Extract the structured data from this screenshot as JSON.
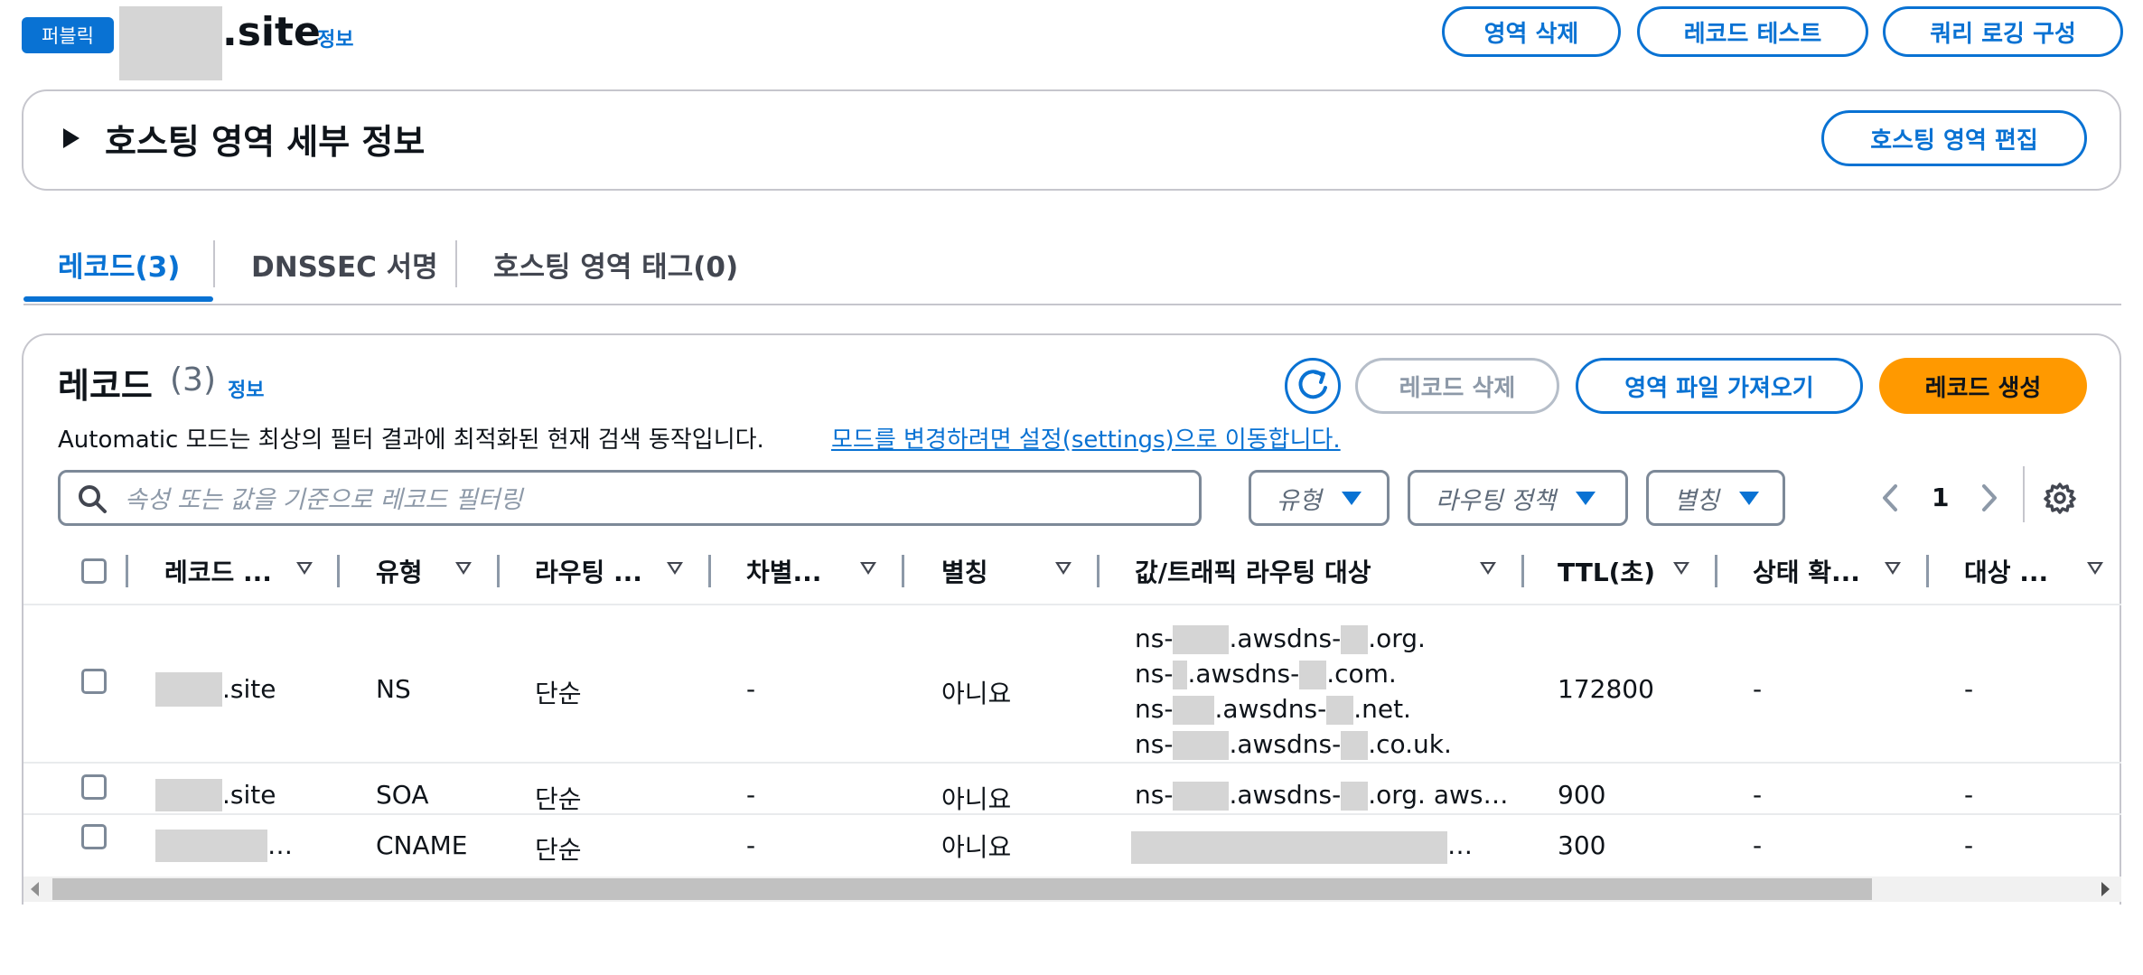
{
  "header": {
    "badge": "퍼블릭",
    "zone_name": ".site",
    "info": "정보",
    "buttons": {
      "delete_zone": "영역 삭제",
      "test_record": "레코드 테스트",
      "query_logging": "쿼리 로깅 구성"
    }
  },
  "details": {
    "title": "호스팅 영역 세부 정보",
    "edit_button": "호스팅 영역 편집"
  },
  "tabs": [
    {
      "label": "레코드(3)",
      "active": true
    },
    {
      "label": "DNSSEC 서명",
      "active": false
    },
    {
      "label": "호스팅 영역 태그(0)",
      "active": false
    }
  ],
  "records": {
    "title": "레코드",
    "count": "(3)",
    "info": "정보",
    "description": "Automatic 모드는 최상의 필터 결과에 최적화된 현재 검색 동작입니다.",
    "description_link": "모드를 변경하려면 설정(settings)으로 이동합니다.",
    "buttons": {
      "delete": "레코드 삭제",
      "import": "영역 파일 가져오기",
      "create": "레코드 생성"
    },
    "search_placeholder": "속성 또는 값을 기준으로 레코드 필터링",
    "filters": {
      "type": "유형",
      "routing_policy": "라우팅 정책",
      "alias": "별칭"
    },
    "page": "1",
    "columns": [
      "레코드 ...",
      "유형",
      "라우팅 ...",
      "차별...",
      "별칭",
      "값/트래픽 라우팅 대상",
      "TTL(초)",
      "상태 확...",
      "대상 ..."
    ],
    "rows": [
      {
        "name": ".site",
        "type": "NS",
        "routing": "단순",
        "diff": "-",
        "alias": "아니요",
        "value_parts": [
          {
            "pre": "ns-",
            "mid": ".awsdns-",
            "post": ".org."
          },
          {
            "pre": "ns-",
            "mid": ".awsdns-",
            "post": ".com."
          },
          {
            "pre": "ns-",
            "mid": ".awsdns-",
            "post": ".net."
          },
          {
            "pre": "ns-",
            "mid": ".awsdns-",
            "post": ".co.uk."
          }
        ],
        "ttl": "172800",
        "health": "-",
        "target": "-"
      },
      {
        "name": ".site",
        "type": "SOA",
        "routing": "단순",
        "diff": "-",
        "alias": "아니요",
        "value_parts": [
          {
            "pre": "ns-",
            "mid": ".awsdns-",
            "post": ".org. aws…"
          }
        ],
        "ttl": "900",
        "health": "-",
        "target": "-"
      },
      {
        "name": "…",
        "type": "CNAME",
        "routing": "단순",
        "diff": "-",
        "alias": "아니요",
        "value_suffix": "…",
        "ttl": "300",
        "health": "-",
        "target": "-"
      }
    ]
  },
  "colors": {
    "accent": "#0972d3",
    "primary_button": "#ff9900",
    "redaction": "#d5d5d5"
  },
  "icons": [
    "search-icon",
    "refresh-icon",
    "settings-icon",
    "chevron-left-icon",
    "chevron-right-icon",
    "caret-right-icon",
    "sort-icon",
    "caret-down-icon"
  ]
}
